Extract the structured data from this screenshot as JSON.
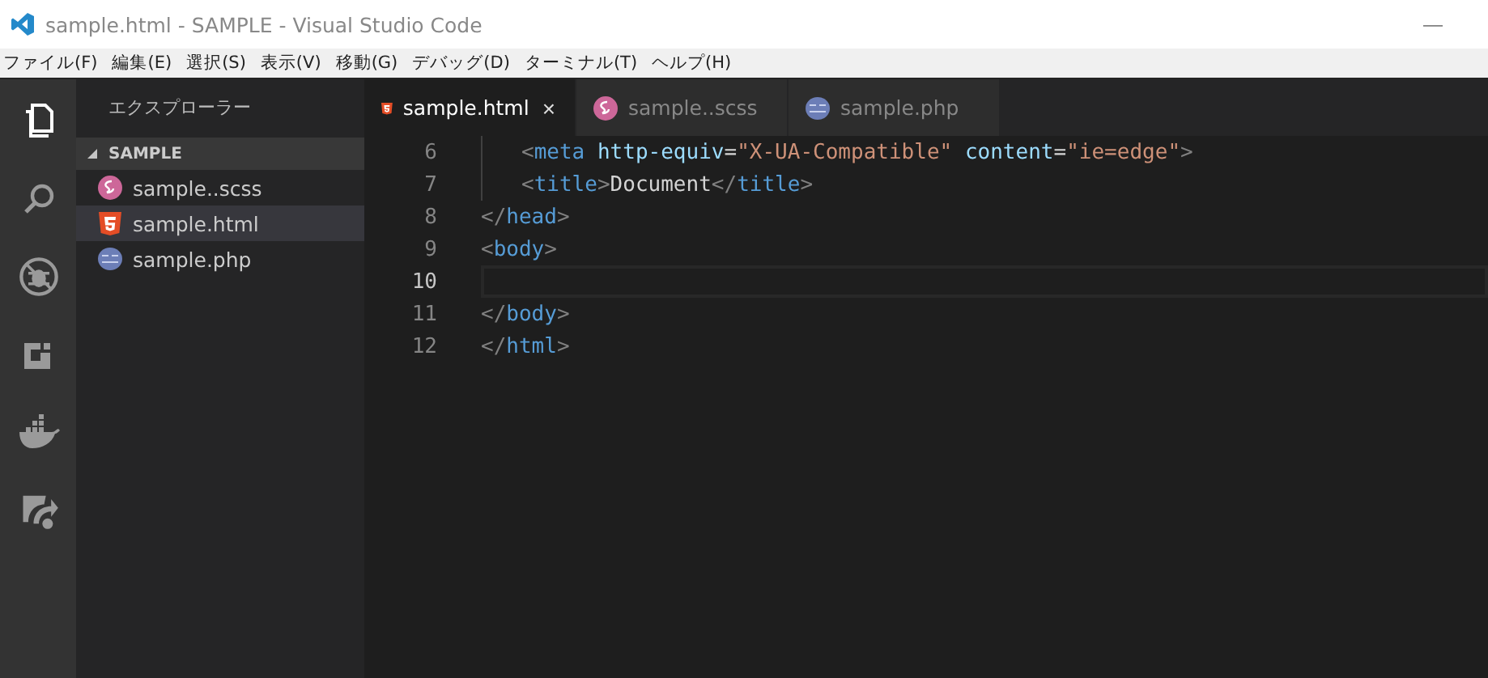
{
  "window": {
    "title": "sample.html - SAMPLE - Visual Studio Code",
    "minimize": "—"
  },
  "menu": [
    "ファイル(F)",
    "編集(E)",
    "選択(S)",
    "表示(V)",
    "移動(G)",
    "デバッグ(D)",
    "ターミナル(T)",
    "ヘルプ(H)"
  ],
  "activity_bar": [
    {
      "kind": "files",
      "selected": true
    },
    {
      "kind": "search",
      "selected": false
    },
    {
      "kind": "debug",
      "selected": false
    },
    {
      "kind": "extensions",
      "selected": false
    },
    {
      "kind": "docker",
      "selected": false
    },
    {
      "kind": "share",
      "selected": false
    }
  ],
  "sidebar": {
    "title": "エクスプローラー",
    "section": {
      "label": "SAMPLE",
      "expanded": true
    },
    "files": [
      {
        "name": "sample..scss",
        "kind": "scss",
        "selected": false
      },
      {
        "name": "sample.html",
        "kind": "html",
        "selected": true
      },
      {
        "name": "sample.php",
        "kind": "php",
        "selected": false
      }
    ]
  },
  "tabs": [
    {
      "label": "sample.html",
      "kind": "html",
      "selected": true,
      "close": "×"
    },
    {
      "label": "sample..scss",
      "kind": "scss",
      "selected": false
    },
    {
      "label": "sample.php",
      "kind": "php",
      "selected": false
    }
  ],
  "editor": {
    "lines": [
      {
        "number": "6",
        "indented": true,
        "current": false,
        "tokens": [
          {
            "kind": "punct",
            "text": "<"
          },
          {
            "kind": "tag",
            "text": "meta"
          },
          {
            "kind": "attr",
            "text": " http-equiv"
          },
          {
            "kind": "text",
            "text": "="
          },
          {
            "kind": "str",
            "text": "\"X-UA-Compatible\""
          },
          {
            "kind": "attr",
            "text": " content"
          },
          {
            "kind": "text",
            "text": "="
          },
          {
            "kind": "str",
            "text": "\"ie=edge\""
          },
          {
            "kind": "punct",
            "text": ">"
          }
        ]
      },
      {
        "number": "7",
        "indented": true,
        "current": false,
        "tokens": [
          {
            "kind": "punct",
            "text": "<"
          },
          {
            "kind": "tag",
            "text": "title"
          },
          {
            "kind": "punct",
            "text": ">"
          },
          {
            "kind": "text",
            "text": "Document"
          },
          {
            "kind": "punct",
            "text": "</"
          },
          {
            "kind": "tag",
            "text": "title"
          },
          {
            "kind": "punct",
            "text": ">"
          }
        ]
      },
      {
        "number": "8",
        "indented": false,
        "current": false,
        "tokens": [
          {
            "kind": "punct",
            "text": "</"
          },
          {
            "kind": "tag",
            "text": "head"
          },
          {
            "kind": "punct",
            "text": ">"
          }
        ]
      },
      {
        "number": "9",
        "indented": false,
        "current": false,
        "tokens": [
          {
            "kind": "punct",
            "text": "<"
          },
          {
            "kind": "tag",
            "text": "body"
          },
          {
            "kind": "punct",
            "text": ">"
          }
        ]
      },
      {
        "number": "10",
        "indented": false,
        "current": true
      },
      {
        "number": "11",
        "indented": false,
        "current": false,
        "tokens": [
          {
            "kind": "punct",
            "text": "</"
          },
          {
            "kind": "tag",
            "text": "body"
          },
          {
            "kind": "punct",
            "text": ">"
          }
        ]
      },
      {
        "number": "12",
        "indented": false,
        "current": false,
        "tokens": [
          {
            "kind": "punct",
            "text": "</"
          },
          {
            "kind": "tag",
            "text": "html"
          },
          {
            "kind": "punct",
            "text": ">"
          }
        ]
      }
    ]
  }
}
